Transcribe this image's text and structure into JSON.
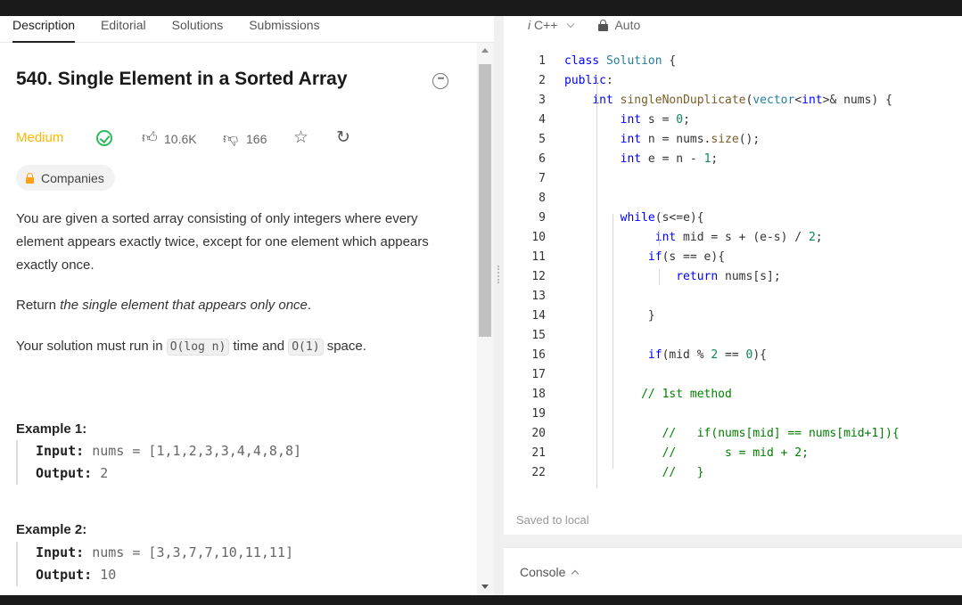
{
  "tabs": [
    "Description",
    "Editorial",
    "Solutions",
    "Submissions"
  ],
  "problem": {
    "title": "540. Single Element in a Sorted Array",
    "difficulty": "Medium",
    "likes": "10.6K",
    "dislikes": "166",
    "companies_label": "Companies",
    "desc_1": "You are given a sorted array consisting of only integers where every element appears exactly twice, except for one element which appears exactly once.",
    "desc_2_prefix": "Return ",
    "desc_2_em": "the single element that appears only once",
    "desc_2_suffix": ".",
    "desc_3_prefix": "Your solution must run in ",
    "desc_3_code1": "O(log n)",
    "desc_3_mid": " time and ",
    "desc_3_code2": "O(1)",
    "desc_3_suffix": " space."
  },
  "examples": [
    {
      "title": "Example 1:",
      "input_label": "Input:",
      "input_value": "nums = [1,1,2,3,3,4,4,8,8]",
      "output_label": "Output:",
      "output_value": "2"
    },
    {
      "title": "Example 2:",
      "input_label": "Input:",
      "input_value": "nums = [3,3,7,7,10,11,11]",
      "output_label": "Output:",
      "output_value": "10"
    }
  ],
  "editor": {
    "language": "C++",
    "mode": "Auto",
    "saved": "Saved to local",
    "lines": [
      "class Solution {",
      "public:",
      "    int singleNonDuplicate(vector<int>& nums) {",
      "        int s = 0;",
      "        int n = nums.size();",
      "        int e = n - 1;",
      "",
      "",
      "        while(s<=e){",
      "             int mid = s + (e-s) / 2;",
      "            if(s == e){",
      "                return nums[s];",
      "",
      "            }",
      "",
      "            if(mid % 2 == 0){",
      "",
      "           // 1st method",
      "",
      "              //   if(nums[mid] == nums[mid+1]){",
      "              //       s = mid + 2;",
      "              //   }"
    ]
  },
  "console": {
    "label": "Console"
  },
  "icons": [
    "more-icon",
    "solved-check-icon",
    "thumbs-up-icon",
    "thumbs-down-icon",
    "star-icon",
    "share-icon",
    "lock-icon",
    "chevron-down-icon",
    "chevron-up-icon"
  ]
}
